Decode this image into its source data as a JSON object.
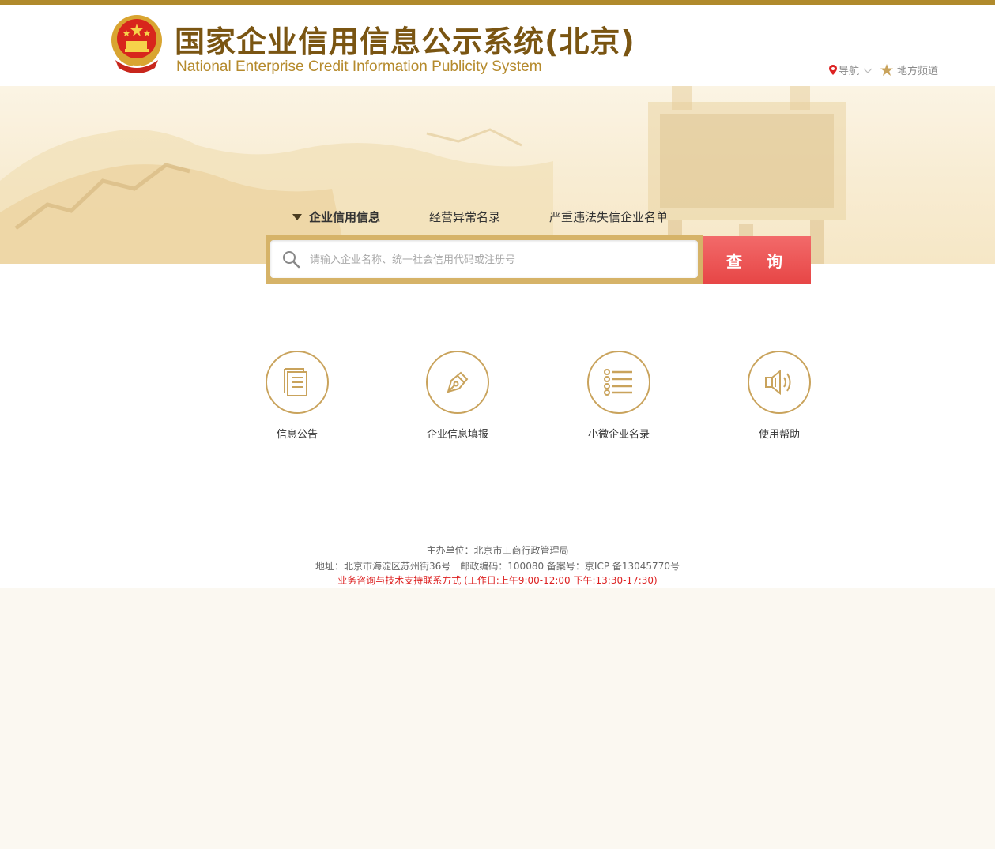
{
  "header": {
    "title_cn": "国家企业信用信息公示系统(北京)",
    "title_en": "National Enterprise Credit Information Publicity System",
    "nav_label": "导航",
    "channel_label": "地方频道"
  },
  "tabs": [
    {
      "label": "企业信用信息",
      "active": true
    },
    {
      "label": "经营异常名录",
      "active": false
    },
    {
      "label": "严重违法失信企业名单",
      "active": false
    }
  ],
  "search": {
    "placeholder": "请输入企业名称、统一社会信用代码或注册号",
    "button_label": "查 询"
  },
  "features": [
    {
      "label": "信息公告",
      "icon": "document-icon"
    },
    {
      "label": "企业信息填报",
      "icon": "pen-icon"
    },
    {
      "label": "小微企业名录",
      "icon": "list-icon"
    },
    {
      "label": "使用帮助",
      "icon": "speaker-icon"
    }
  ],
  "footer": {
    "sponsor": "主办单位：北京市工商行政管理局",
    "address": "地址：北京市海淀区苏州街36号　邮政编码：100080 备案号：京ICP 备13045770号",
    "contact": "业务咨询与技术支持联系方式 (工作日:上午9:00-12:00 下午:13:30-17:30)"
  },
  "colors": {
    "gold": "#b08a2c",
    "title_brown": "#7a5512",
    "search_red": "#e74646",
    "contact_red": "#dd2222"
  }
}
